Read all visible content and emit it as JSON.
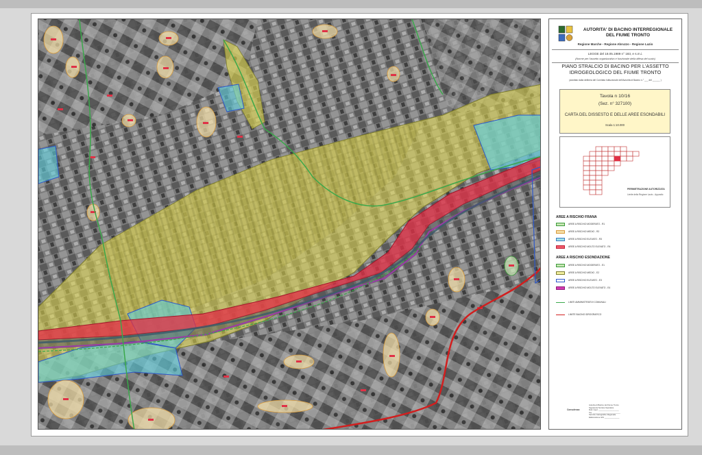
{
  "header": {
    "authority_line1": "AUTORITA' DI BACINO INTERREGIONALE",
    "authority_line2": "DEL FIUME TRONTO",
    "regions": "Regione Marche - Regione Abruzzo - Regione Lazio",
    "law": "LEGGE del 18.05.1989 n° 183, e s.m.i.",
    "law_note": "(Norme per l'assetto organizzativo e funzionale della difesa del suolo)",
    "plan_line1": "PIANO STRALCIO DI BACINO PER L'ASSETTO",
    "plan_line2": "IDROGEOLOGICO DEL FIUME TRONTO",
    "plan_sub": "(adottato dalla delibera del Comitato Istituzionale dell'Autorità di Bacino n.° ___ del ______ )"
  },
  "tavola": {
    "number": "Tavola n 10/16",
    "section": "(Sez. n° 327100)",
    "title": "CARTA DEL DISSESTO E DELLE AREE ESONDABILI",
    "scale": "Scala 1:10.000"
  },
  "key_map": {
    "label1": "PERIMETRAZIONE AUTORIZZATA",
    "label2": "Limite della Regione Lazio - Apposito"
  },
  "legend": {
    "frana_title": "AREE A RISCHIO FRANA",
    "frana_items": [
      {
        "label": "AREE A RISCHIO MODERATO - R1",
        "fill": "#c8e6b4",
        "stroke": "#3a9a3a"
      },
      {
        "label": "AREE A RISCHIO MEDIO - R2",
        "fill": "#f5dfa8",
        "stroke": "#d89a3a"
      },
      {
        "label": "AREE A RISCHIO ELEVATO - R3",
        "fill": "#9ee0e8",
        "stroke": "#3b7bbf"
      },
      {
        "label": "AREE A RISCHIO MOLTO ELEVATO - R4",
        "fill": "#ef5b6a",
        "stroke": "#c0203a"
      }
    ],
    "esondazione_title": "AREE A RISCHIO ESONDAZIONE",
    "esondazione_items": [
      {
        "label": "AREE A RISCHIO MODERATO - E1",
        "fill": "#c8e6b4",
        "stroke": "#3a9a3a"
      },
      {
        "label": "AREE A RISCHIO MEDIO - E2",
        "fill": "#f3f0a0",
        "stroke": "#7a7a2a"
      },
      {
        "label": "AREE A RISCHIO ELEVATO - E3",
        "fill": "#ffffff",
        "stroke": "#2c57c9"
      },
      {
        "label": "AREE A RISCHIO MOLTO ELEVATO - E4",
        "fill": "#d23ab0",
        "stroke": "#8c1c78"
      }
    ],
    "line_items": [
      {
        "label": "LIMITI AMMINISTRATIVI COMUNALI",
        "color": "#3aa84a"
      },
      {
        "label": "LIMITE BACINO IDROGRAFICO",
        "color": "#d21e1e"
      }
    ]
  },
  "credits": {
    "label": "Consulenza:",
    "lines": [
      "Autorita di Bacino del Fiume Tronto",
      "Segreteria Tecnica Operativa",
      "Dott. Geol. ___________________",
      "Ing. __________________________",
      "Servizio Cartografico Regionale",
      "Elaborazione GIS ______________"
    ]
  },
  "colors": {
    "e2_yellow": "#e3db4e",
    "e3_cyan": "#5fd0e0",
    "r4_red": "#e03146",
    "boundary_red": "#d21e1e",
    "admin_green": "#3aa84a",
    "photo_gray": "#6e6e6e"
  },
  "icons": {
    "logo": "coat-of-arms-icon"
  }
}
